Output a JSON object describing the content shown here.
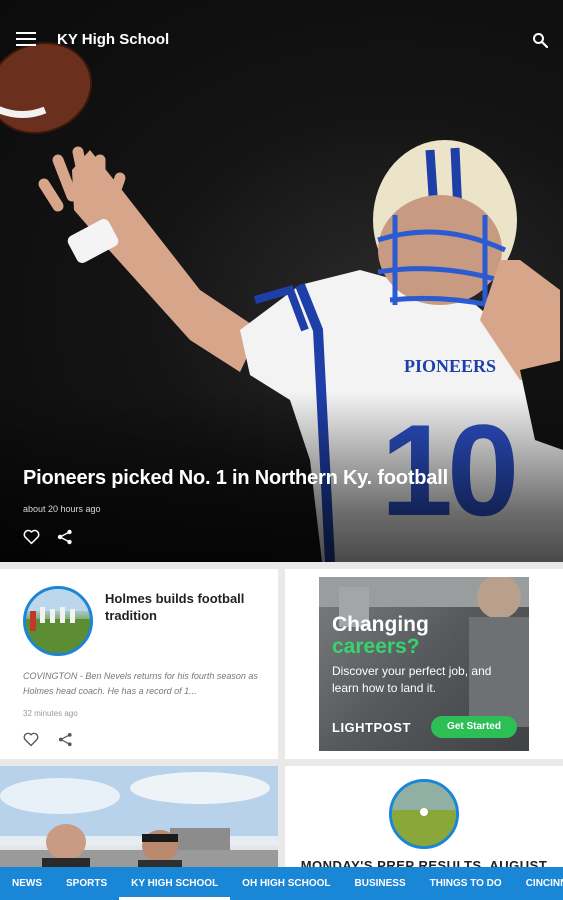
{
  "app": {
    "title": "KY High School"
  },
  "hero": {
    "headline": "Pioneers picked No. 1 in Northern Ky. football",
    "time": "about 20 hours ago",
    "jersey_text": "PIONEERS",
    "jersey_number": "10"
  },
  "cards": [
    {
      "title": "Holmes builds football tradition",
      "excerpt": "COVINGTON - Ben Nevels returns for his fourth season as Holmes head coach. He has a record of 1...",
      "time": "32 minutes ago"
    },
    {
      "ad": {
        "headline_line1": "Changing",
        "headline_line2": "careers?",
        "body": "Discover your perfect job, and learn how to land it.",
        "logo": "LIGHTPOST",
        "cta": "Get Started"
      }
    },
    {
      "title": ""
    },
    {
      "title": "MONDAY'S PREP RESULTS, AUGUST"
    }
  ],
  "nav": {
    "items": [
      "NEWS",
      "SPORTS",
      "KY HIGH SCHOOL",
      "OH HIGH SCHOOL",
      "BUSINESS",
      "THINGS TO DO",
      "CINCINNATI"
    ],
    "active_index": 2
  },
  "colors": {
    "accent": "#1a86d6",
    "cta_green": "#2bbf55",
    "ad_green": "#36d46e"
  }
}
